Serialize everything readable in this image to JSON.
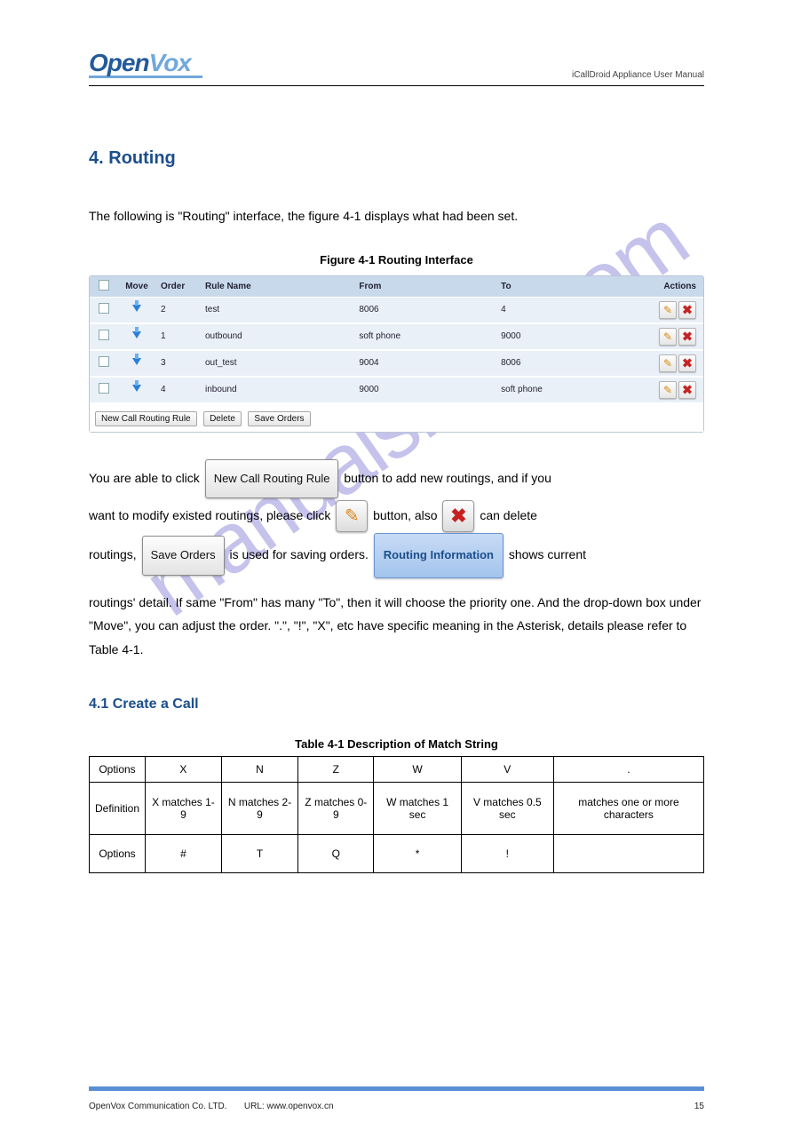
{
  "header": {
    "logo_part1": "Open",
    "logo_part2": "Vox",
    "product_line": "iCallDroid Appliance User Manual"
  },
  "section": {
    "number": "4. ",
    "title": "Routing"
  },
  "paragraphs": {
    "intro": "The following is \"Routing\" interface, the figure 4-1 displays what had been set.",
    "p1a": "You are able to click ",
    "p1b": " button to add new routings, and if you",
    "p1c": "want to modify existed routings, please click ",
    "p1d": " button, also ",
    "p1e": " can delete",
    "p1f": "routings, ",
    "p1g": " is used for saving orders. ",
    "p1h": " shows current"
  },
  "figure1_caption": "Figure 4-1 Routing Interface",
  "routing_table": {
    "headers": [
      "",
      "Move",
      "Order",
      "Rule Name",
      "From",
      "To",
      "Actions"
    ],
    "rows": [
      {
        "order": "2",
        "rule": "test",
        "from": "8006",
        "to": "4"
      },
      {
        "order": "1",
        "rule": "outbound",
        "from": "soft phone",
        "to": "9000"
      },
      {
        "order": "3",
        "rule": "out_test",
        "from": "9004",
        "to": "8006"
      },
      {
        "order": "4",
        "rule": "inbound",
        "from": "9000",
        "to": "soft phone"
      }
    ],
    "footer_buttons": [
      "New Call Routing Rule",
      "Delete",
      "Save Orders"
    ]
  },
  "inline_buttons": {
    "new_rule": "New Call Routing Rule",
    "save_orders": "Save Orders",
    "routing_info": "Routing Information"
  },
  "paragraph2": "routings' detail. If same \"From\" has many \"To\", then it will choose the priority one. And the drop-down box under \"Move\", you can adjust the order. \".\", \"!\", \"X\", etc have specific meaning in the Asterisk, details please refer to Table 4-1.",
  "subsection": {
    "number": "4.1 ",
    "title": "Create a Call"
  },
  "table_caption": "Table 4-1 Description of Match String",
  "match_table": {
    "r1": [
      "Options",
      "X",
      "N",
      "Z",
      "W",
      "V",
      "."
    ],
    "r2": [
      "Definition",
      "X matches 1-9",
      "N matches 2-9",
      "Z matches 0-9",
      "W matches 1 sec",
      "V matches 0.5 sec",
      "matches one or more characters"
    ],
    "r3": [
      "Options",
      "#",
      "T",
      "Q",
      "*",
      "!",
      ""
    ]
  },
  "footer": {
    "company": "OpenVox Communication Co. LTD.",
    "url": "URL: www.openvox.cn",
    "page": "15"
  },
  "watermark_text": "manualshive.com"
}
